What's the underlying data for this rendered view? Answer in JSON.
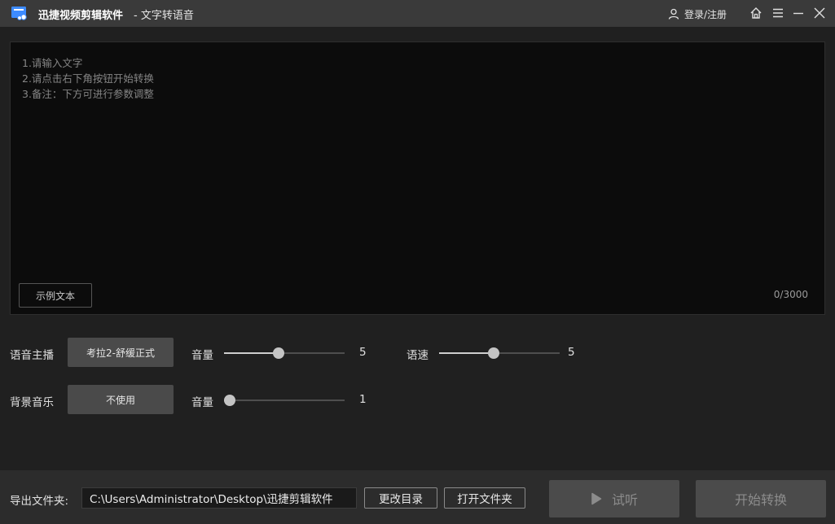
{
  "titlebar": {
    "app_name": "迅捷视频剪辑软件",
    "subtitle": "- 文字转语音",
    "login_label": "登录/注册",
    "icons": [
      "user-icon",
      "home-icon",
      "menu-icon",
      "minimize-icon",
      "close-icon"
    ]
  },
  "editor": {
    "value": "",
    "hint_lines": [
      "1.请输入文字",
      "2.请点击右下角按钮开始转换",
      "3.备注：下方可进行参数调整"
    ],
    "sample_button": "示例文本",
    "counter": "0/3000"
  },
  "voice": {
    "label": "语音主播",
    "selected": "考拉2-舒缓正式",
    "volume_label": "音量",
    "volume_value": "5",
    "volume_fraction": 0.45,
    "speed_label": "语速",
    "speed_value": "5",
    "speed_fraction": 0.45
  },
  "bgm": {
    "label": "背景音乐",
    "selected": "不使用",
    "volume_label": "音量",
    "volume_value": "1",
    "volume_fraction": 0.0
  },
  "footer": {
    "export_label": "导出文件夹:",
    "path": "C:\\Users\\Administrator\\Desktop\\迅捷剪辑软件",
    "change_dir_button": "更改目录",
    "open_folder_button": "打开文件夹",
    "preview_button": "试听",
    "start_button": "开始转换"
  },
  "colors": {
    "titlebar_bg": "#3a3a3a",
    "body_bg": "#202020",
    "editor_bg": "#0c0c0c",
    "button_bg": "#4a4a4a"
  }
}
